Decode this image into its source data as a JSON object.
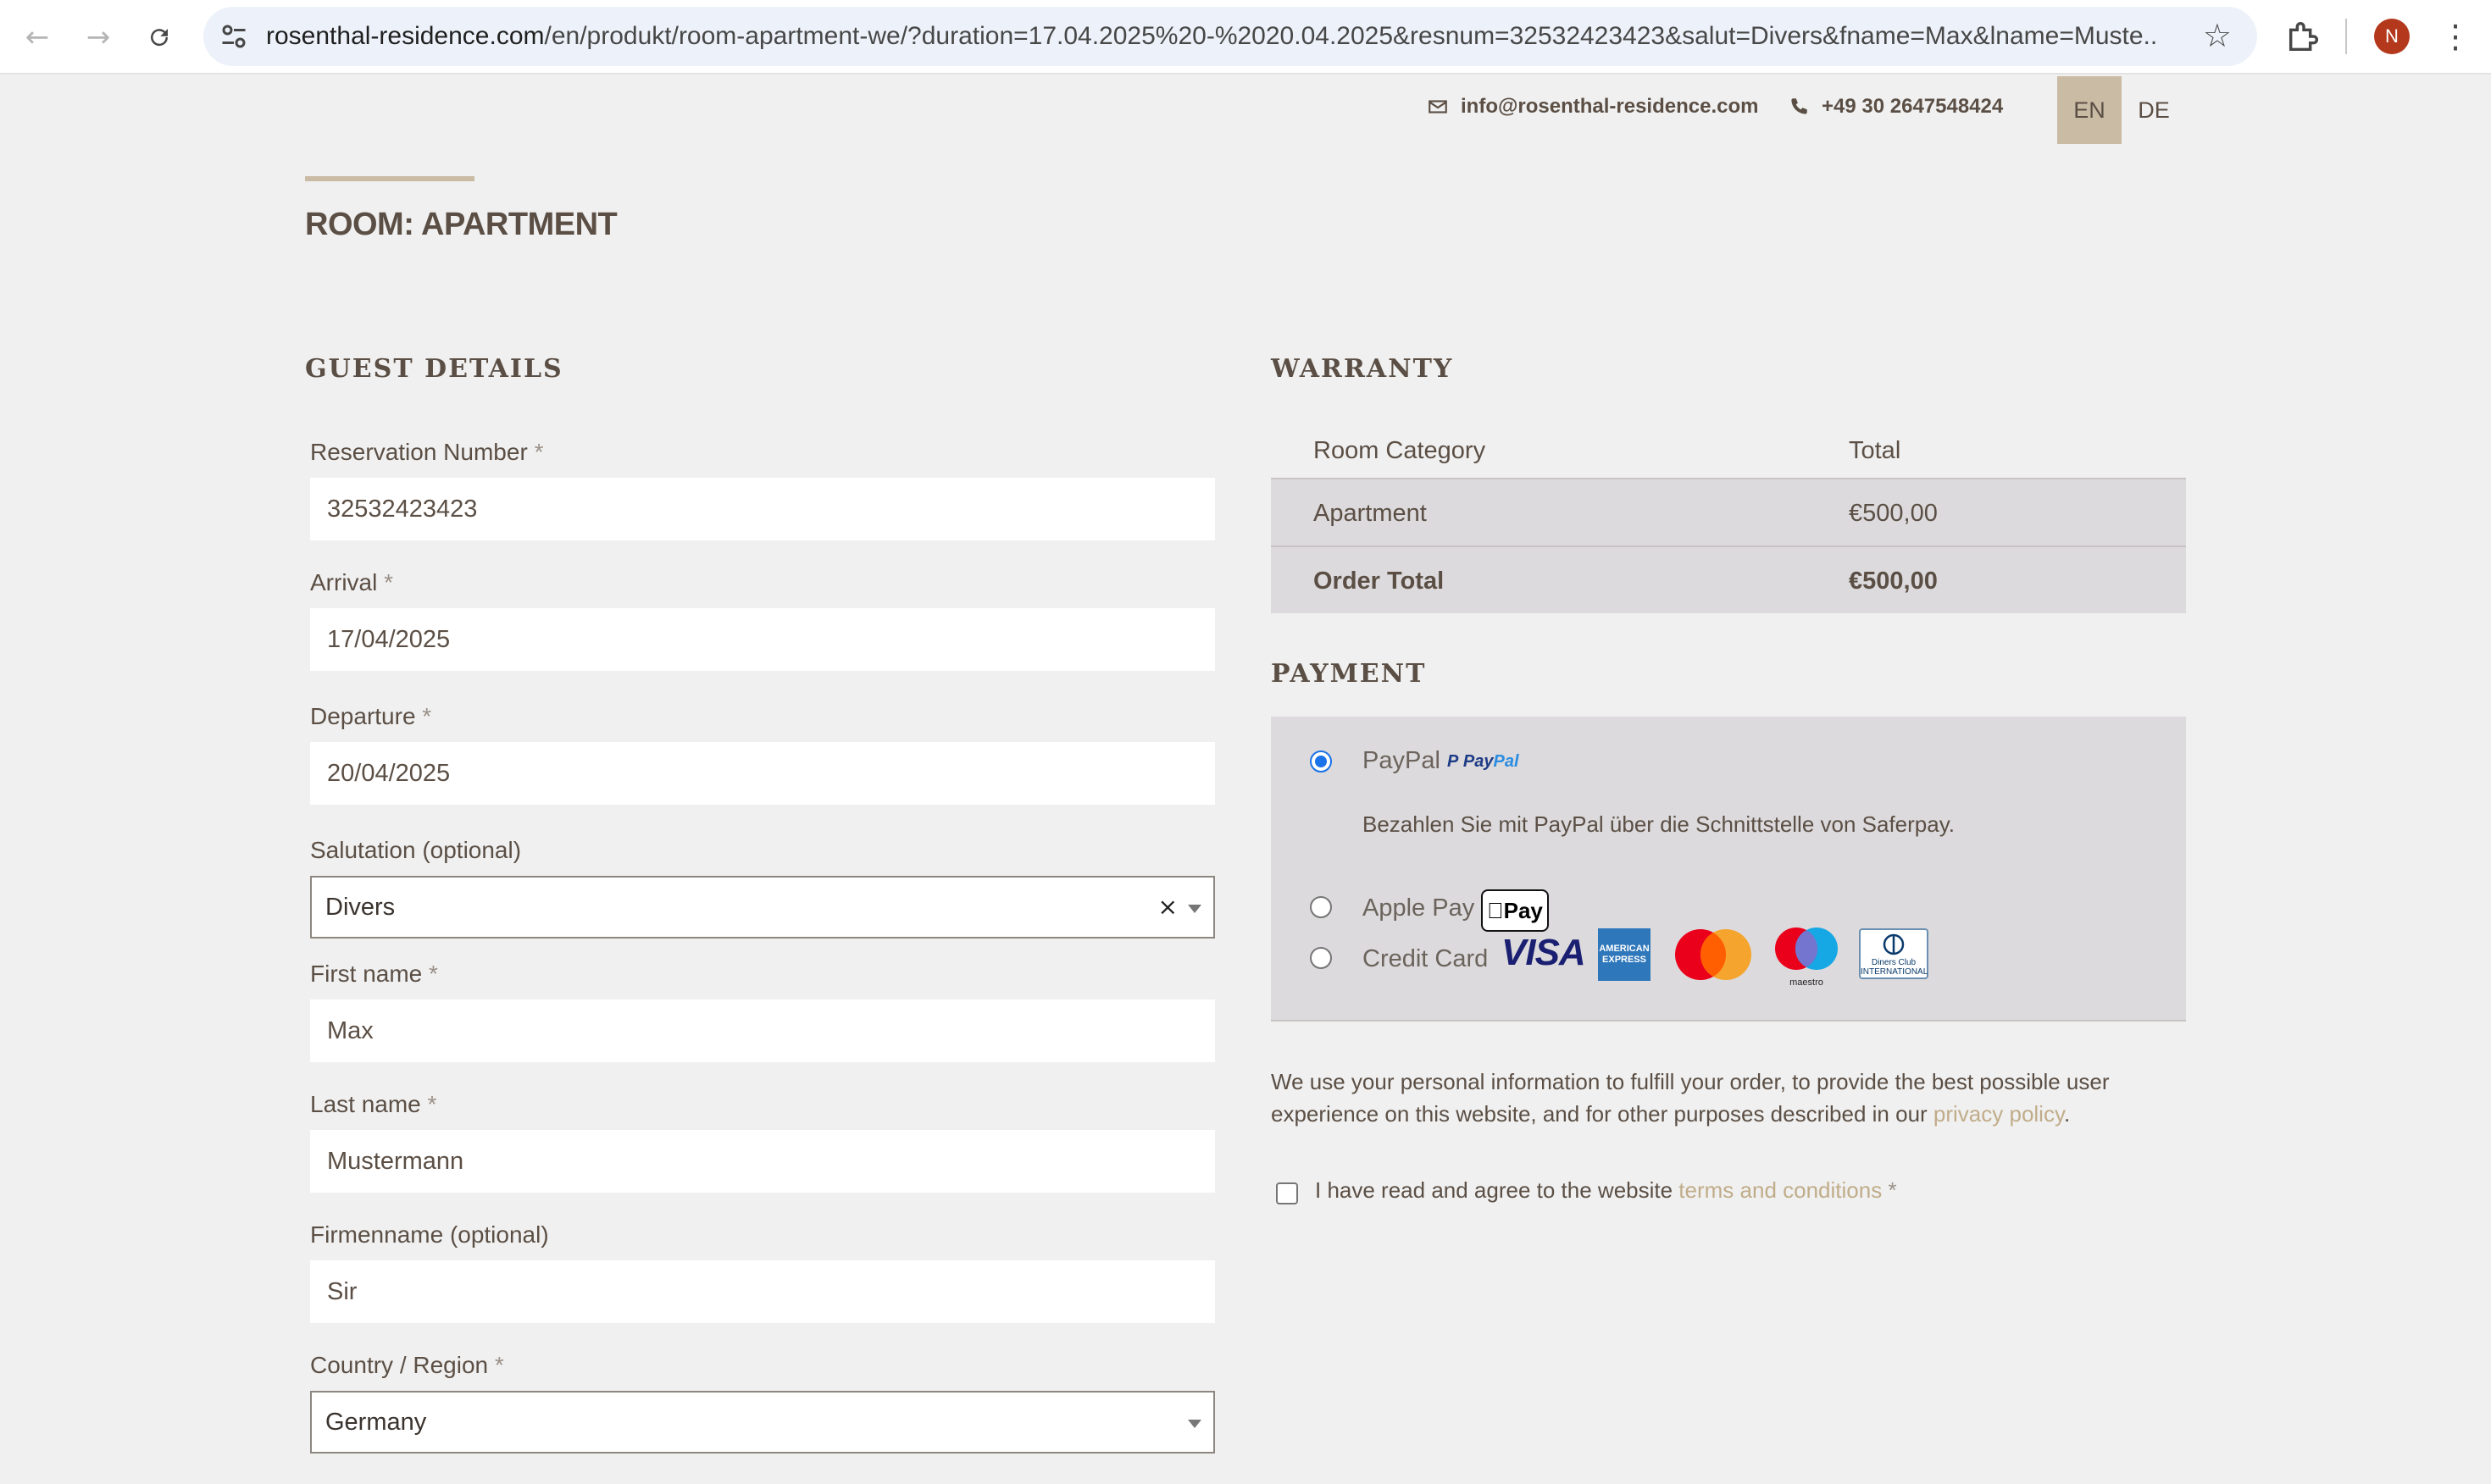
{
  "browser": {
    "url_host": "rosenthal-residence.com",
    "url_path": "/en/produkt/room-apartment-we/?duration=17.04.2025%20-%2020.04.2025&resnum=32532423423&salut=Divers&fname=Max&lname=Muste...",
    "avatar_letter": "N"
  },
  "header": {
    "email": "info@rosenthal-residence.com",
    "phone": "+49 30 2647548424",
    "lang_en": "EN",
    "lang_de": "DE"
  },
  "page": {
    "title": "ROOM: APARTMENT"
  },
  "guest": {
    "heading": "GUEST DETAILS",
    "required_mark": "*",
    "reservation_label": "Reservation Number",
    "reservation_value": "32532423423",
    "arrival_label": "Arrival",
    "arrival_value": "17/04/2025",
    "departure_label": "Departure",
    "departure_value": "20/04/2025",
    "salutation_label": "Salutation (optional)",
    "salutation_value": "Divers",
    "clear_glyph": "×",
    "firstname_label": "First name",
    "firstname_value": "Max",
    "lastname_label": "Last name",
    "lastname_value": "Mustermann",
    "company_label": "Firmenname (optional)",
    "company_value": "Sir",
    "country_label": "Country / Region",
    "country_value": "Germany"
  },
  "warranty": {
    "heading": "WARRANTY",
    "col_category": "Room Category",
    "col_total": "Total",
    "item_name": "Apartment",
    "item_total": "€500,00",
    "order_total_label": "Order Total",
    "order_total_value": "€500,00"
  },
  "payment": {
    "heading": "PAYMENT",
    "paypal_label": "PayPal",
    "paypal_mark_a": "Pay",
    "paypal_mark_b": "Pal",
    "paypal_desc": "Bezahlen Sie mit PayPal über die Schnittstelle von Saferpay.",
    "applepay_label": "Apple Pay",
    "applepay_mark": "Pay",
    "creditcard_label": "Credit Card",
    "visa_mark": "VISA",
    "amex_mark": "AMERICAN EXPRESS",
    "maestro_mark": "maestro",
    "diners_mark": "Diners Club INTERNATIONAL"
  },
  "privacy": {
    "text": "We use your personal information to fulfill your order, to provide the best possible user experience on this website, and for other purposes described in our ",
    "link": "privacy policy",
    "end": "."
  },
  "terms": {
    "text": "I have read and agree to the website ",
    "link": "terms and conditions",
    "required_mark": "*"
  }
}
